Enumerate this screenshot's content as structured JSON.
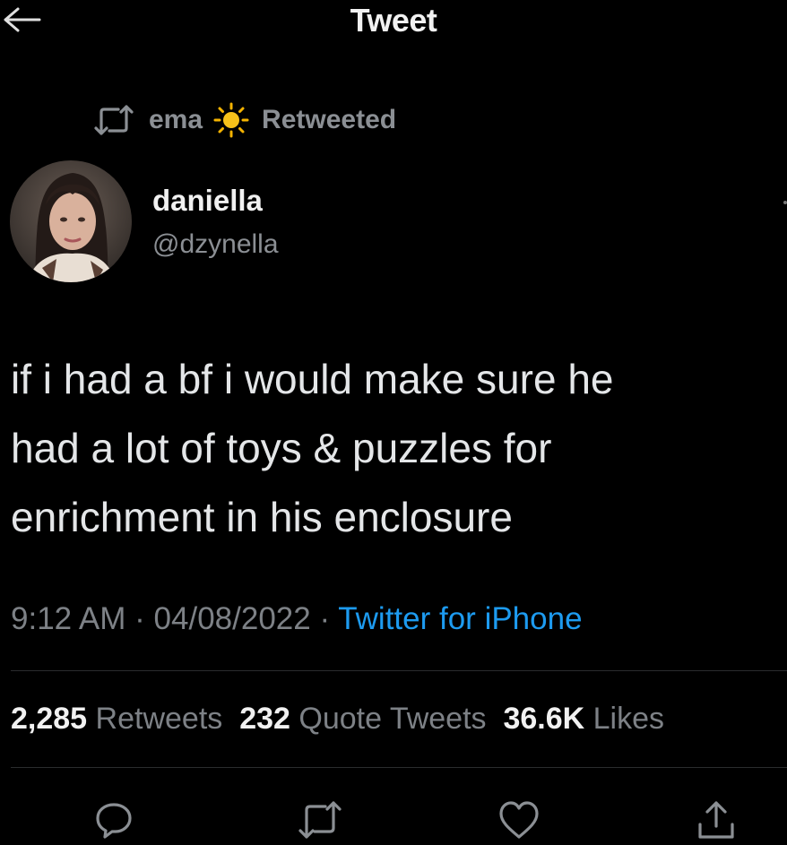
{
  "header": {
    "title": "Tweet",
    "back_icon": "arrow-left-icon"
  },
  "retweet_context": {
    "icon": "retweet-icon",
    "user": "ema",
    "emoji": "sun-icon",
    "label": "Retweeted"
  },
  "author": {
    "display_name": "daniella",
    "handle": "@dzynella",
    "avatar": "avatar-photo"
  },
  "tweet": {
    "lines": [
      "if i had a bf i would make sure he",
      "had a lot of toys & puzzles for",
      "enrichment in his enclosure"
    ],
    "time": "9:12 AM",
    "date": "04/08/2022",
    "separator": "·",
    "source": "Twitter for iPhone"
  },
  "stats": {
    "retweets_count": "2,285",
    "retweets_label": "Retweets",
    "quotes_count": "232",
    "quotes_label": "Quote Tweets",
    "likes_count": "36.6K",
    "likes_label": "Likes"
  },
  "actions": [
    "reply-icon",
    "retweet-icon",
    "like-icon",
    "share-icon"
  ],
  "colors": {
    "background": "#000000",
    "text": "#e7e9ea",
    "secondary": "#7d8186",
    "link": "#1d9bf0",
    "sun": "#f5b301"
  }
}
